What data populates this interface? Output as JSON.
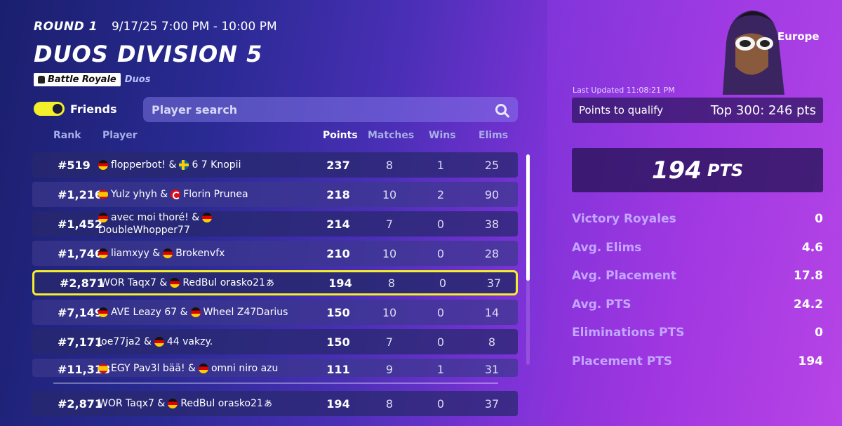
{
  "header": {
    "round": "ROUND 1",
    "time": "9/17/25 7:00 PM - 10:00 PM",
    "title": "DUOS DIVISION 5",
    "mode": "Battle Royale",
    "submode": "Duos"
  },
  "filters": {
    "friends_label": "Friends",
    "friends_on": true,
    "search_placeholder": "Player search"
  },
  "columns": {
    "rank": "Rank",
    "player": "Player",
    "points": "Points",
    "matches": "Matches",
    "wins": "Wins",
    "elims": "Elims"
  },
  "rows": [
    {
      "rank": "#519",
      "p1": "flopperbot! &",
      "f1": "de",
      "f2": "se",
      "p2": "6 7 Knopii",
      "points": "237",
      "matches": "8",
      "wins": "1",
      "elims": "25"
    },
    {
      "rank": "#1,216",
      "p1": "Yulz yhyh &",
      "f1": "es",
      "f2": "tr",
      "p2": "Florin Prunea",
      "points": "218",
      "matches": "10",
      "wins": "2",
      "elims": "90"
    },
    {
      "rank": "#1,452",
      "p1": "avec moi thoré! &",
      "f1": "de",
      "f2": "de",
      "p2": "DoubleWhopper77",
      "points": "214",
      "matches": "7",
      "wins": "0",
      "elims": "38"
    },
    {
      "rank": "#1,746",
      "p1": "liamxyy &",
      "f1": "de",
      "f2": "de",
      "p2": "Brokenvfx",
      "points": "210",
      "matches": "10",
      "wins": "0",
      "elims": "28"
    },
    {
      "rank": "#2,871",
      "p1": "WOR Taqx7 &",
      "f1": "",
      "f2": "de",
      "p2": "RedBul orasko21ぁ",
      "points": "194",
      "matches": "8",
      "wins": "0",
      "elims": "37"
    },
    {
      "rank": "#7,149",
      "p1": "AVE Leazy 67 &",
      "f1": "de",
      "f2": "de",
      "p2": "Wheel Z47Darius",
      "points": "150",
      "matches": "10",
      "wins": "0",
      "elims": "14"
    },
    {
      "rank": "#7,171",
      "p1": "Joe77ja2 &",
      "f1": "",
      "f2": "de",
      "p2": "44 vakzy.",
      "points": "150",
      "matches": "7",
      "wins": "0",
      "elims": "8"
    },
    {
      "rank": "#11,318",
      "p1": "EGY Pav3l bää! &",
      "f1": "es",
      "f2": "de",
      "p2": "omni niro azu",
      "points": "111",
      "matches": "9",
      "wins": "1",
      "elims": "31"
    }
  ],
  "my_row": {
    "rank": "#2,871",
    "p1": "WOR Taqx7 &",
    "f2": "de",
    "p2": "RedBul orasko21ぁ",
    "points": "194",
    "matches": "8",
    "wins": "0",
    "elims": "37"
  },
  "side": {
    "region": "Europe",
    "last_updated": "Last Updated 11:08:21 PM",
    "qualify_label": "Points to qualify",
    "qualify_value": "Top 300: 246 pts",
    "points_value": "194",
    "points_unit": "PTS",
    "stats": [
      {
        "label": "Victory Royales",
        "value": "0"
      },
      {
        "label": "Avg. Elims",
        "value": "4.6"
      },
      {
        "label": "Avg. Placement",
        "value": "17.8"
      },
      {
        "label": "Avg. PTS",
        "value": "24.2"
      },
      {
        "label": "Eliminations PTS",
        "value": "0"
      },
      {
        "label": "Placement PTS",
        "value": "194"
      }
    ]
  },
  "colors": {
    "accent_yellow": "#f5ee2a",
    "stat_label": "#c3a6ff"
  }
}
